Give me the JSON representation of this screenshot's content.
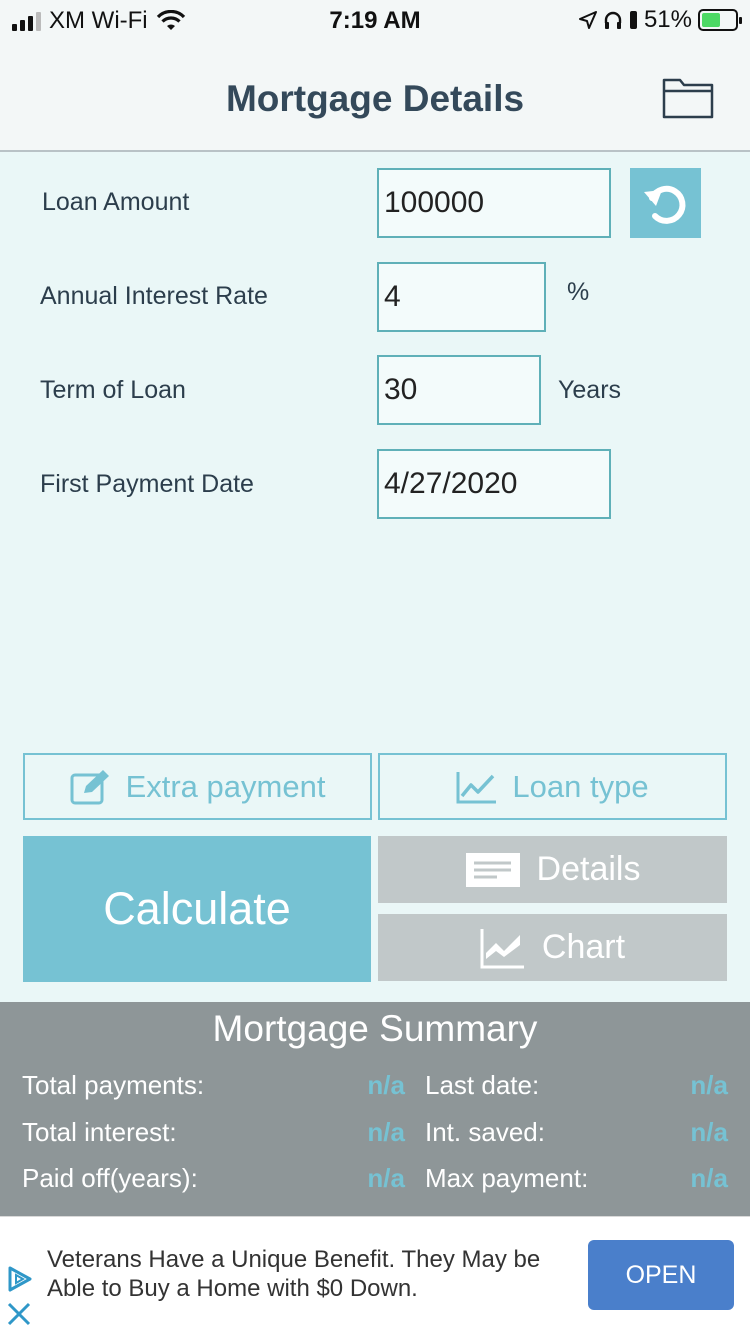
{
  "status_bar": {
    "carrier": "XM Wi-Fi",
    "time": "7:19 AM",
    "battery_percent": "51%"
  },
  "header": {
    "title": "Mortgage Details"
  },
  "form": {
    "loan_amount_label": "Loan Amount",
    "loan_amount_value": "100000",
    "interest_label": "Annual Interest Rate",
    "interest_value": "4",
    "interest_unit": "%",
    "term_label": "Term of Loan",
    "term_value": "30",
    "term_unit": "Years",
    "first_payment_label": "First Payment Date",
    "first_payment_value": "4/27/2020"
  },
  "buttons": {
    "extra_payment": "Extra payment",
    "loan_type": "Loan type",
    "calculate": "Calculate",
    "details": "Details",
    "chart": "Chart"
  },
  "summary": {
    "title": "Mortgage Summary",
    "total_payments_label": "Total payments:",
    "total_payments_value": "n/a",
    "total_interest_label": "Total interest:",
    "total_interest_value": "n/a",
    "paid_off_label": "Paid off(years):",
    "paid_off_value": "n/a",
    "last_date_label": "Last date:",
    "last_date_value": "n/a",
    "int_saved_label": "Int. saved:",
    "int_saved_value": "n/a",
    "max_payment_label": "Max payment:",
    "max_payment_value": "n/a"
  },
  "ad": {
    "text": "Veterans Have a Unique Benefit. They May be Able to Buy a Home with $0 Down.",
    "open_label": "OPEN"
  },
  "colors": {
    "accent": "#76c2d3",
    "background": "#eaf7f7",
    "summary_bg": "#8e9698",
    "ad_button": "#4a7fcb"
  }
}
